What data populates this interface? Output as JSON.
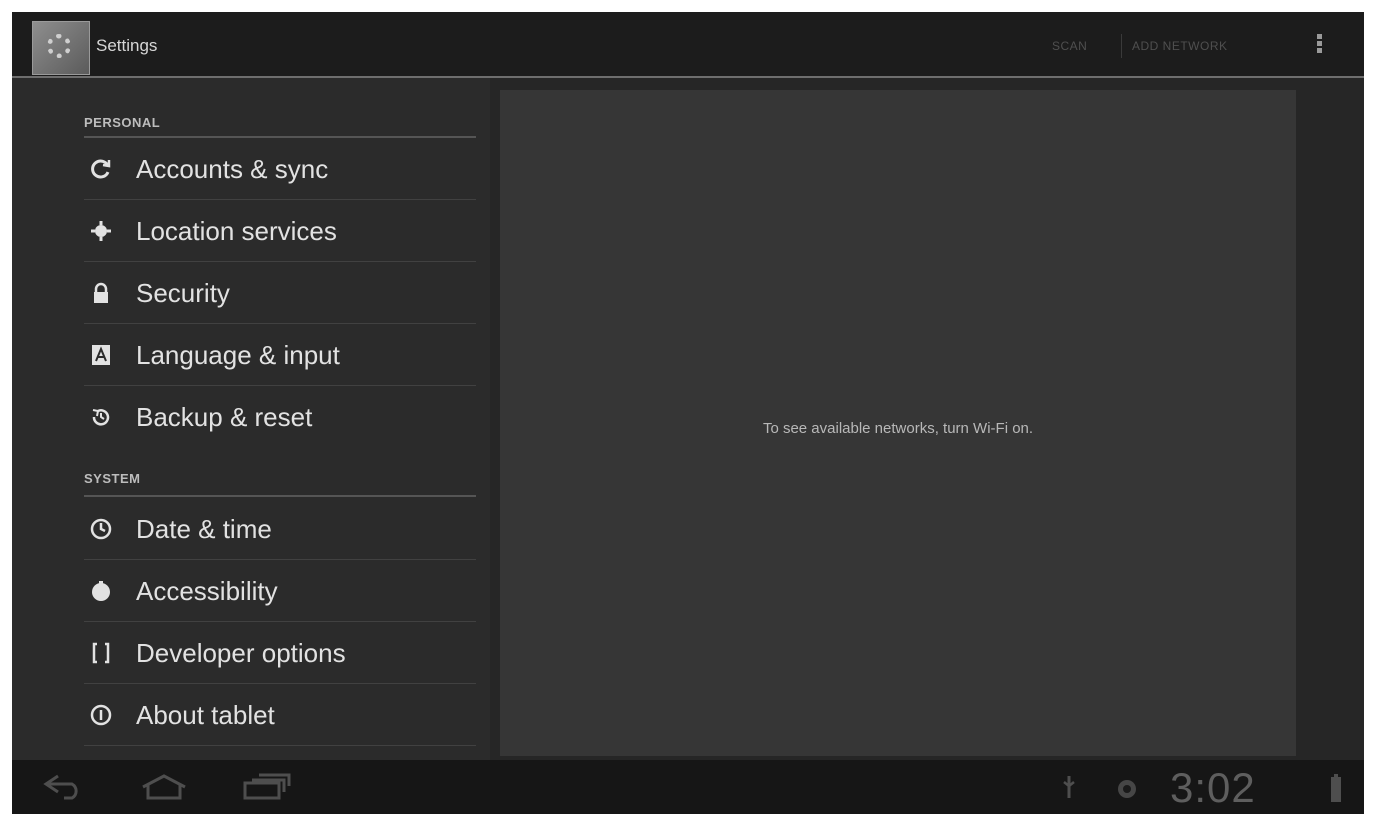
{
  "action_bar": {
    "title": "Settings",
    "scan_label": "SCAN",
    "add_network_label": "ADD NETWORK"
  },
  "settings": {
    "sections": [
      {
        "header": "PERSONAL",
        "items": [
          {
            "label": "Accounts & sync",
            "icon": "sync-icon"
          },
          {
            "label": "Location services",
            "icon": "location-icon"
          },
          {
            "label": "Security",
            "icon": "lock-icon"
          },
          {
            "label": "Language & input",
            "icon": "keyboard-language-icon"
          },
          {
            "label": "Backup & reset",
            "icon": "backup-icon"
          }
        ]
      },
      {
        "header": "SYSTEM",
        "items": [
          {
            "label": "Date & time",
            "icon": "clock-icon"
          },
          {
            "label": "Accessibility",
            "icon": "accessibility-icon"
          },
          {
            "label": "Developer options",
            "icon": "braces-icon"
          },
          {
            "label": "About tablet",
            "icon": "info-icon"
          }
        ]
      }
    ]
  },
  "detail": {
    "message": "To see available networks, turn Wi-Fi on."
  },
  "system_bar": {
    "time": "3:02"
  },
  "colors": {
    "background": "#262626",
    "list_background": "#2b2b2b",
    "pane_background": "#363636",
    "text": "#e2e2e2"
  }
}
